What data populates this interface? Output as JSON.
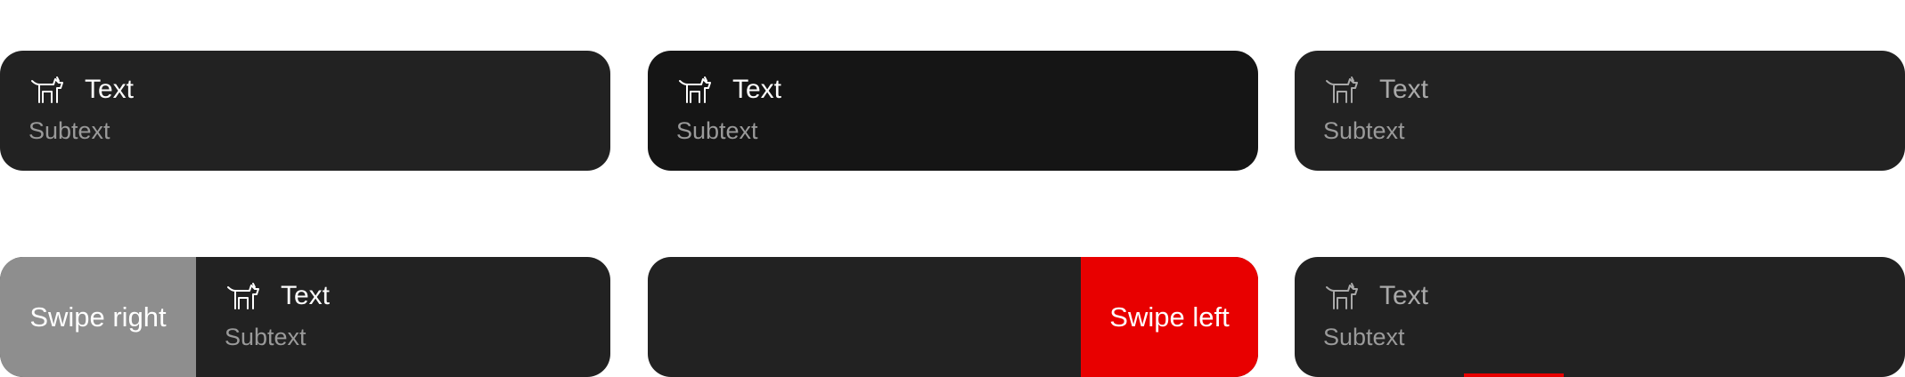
{
  "icon": "dog-icon",
  "colors": {
    "card_bg": "#222222",
    "card_bg_pressed": "#151515",
    "swipe_right_bg": "#8e8e8e",
    "swipe_left_bg": "#e80000"
  },
  "cards": [
    {
      "title": "Text",
      "subtitle": "Subtext"
    },
    {
      "title": "Text",
      "subtitle": "Subtext"
    },
    {
      "title": "Text",
      "subtitle": "Subtext"
    },
    {
      "action": "Swipe right",
      "title": "Text",
      "subtitle": "Subtext"
    },
    {
      "action": "Swipe left"
    },
    {
      "title": "Text",
      "subtitle": "Subtext"
    }
  ]
}
